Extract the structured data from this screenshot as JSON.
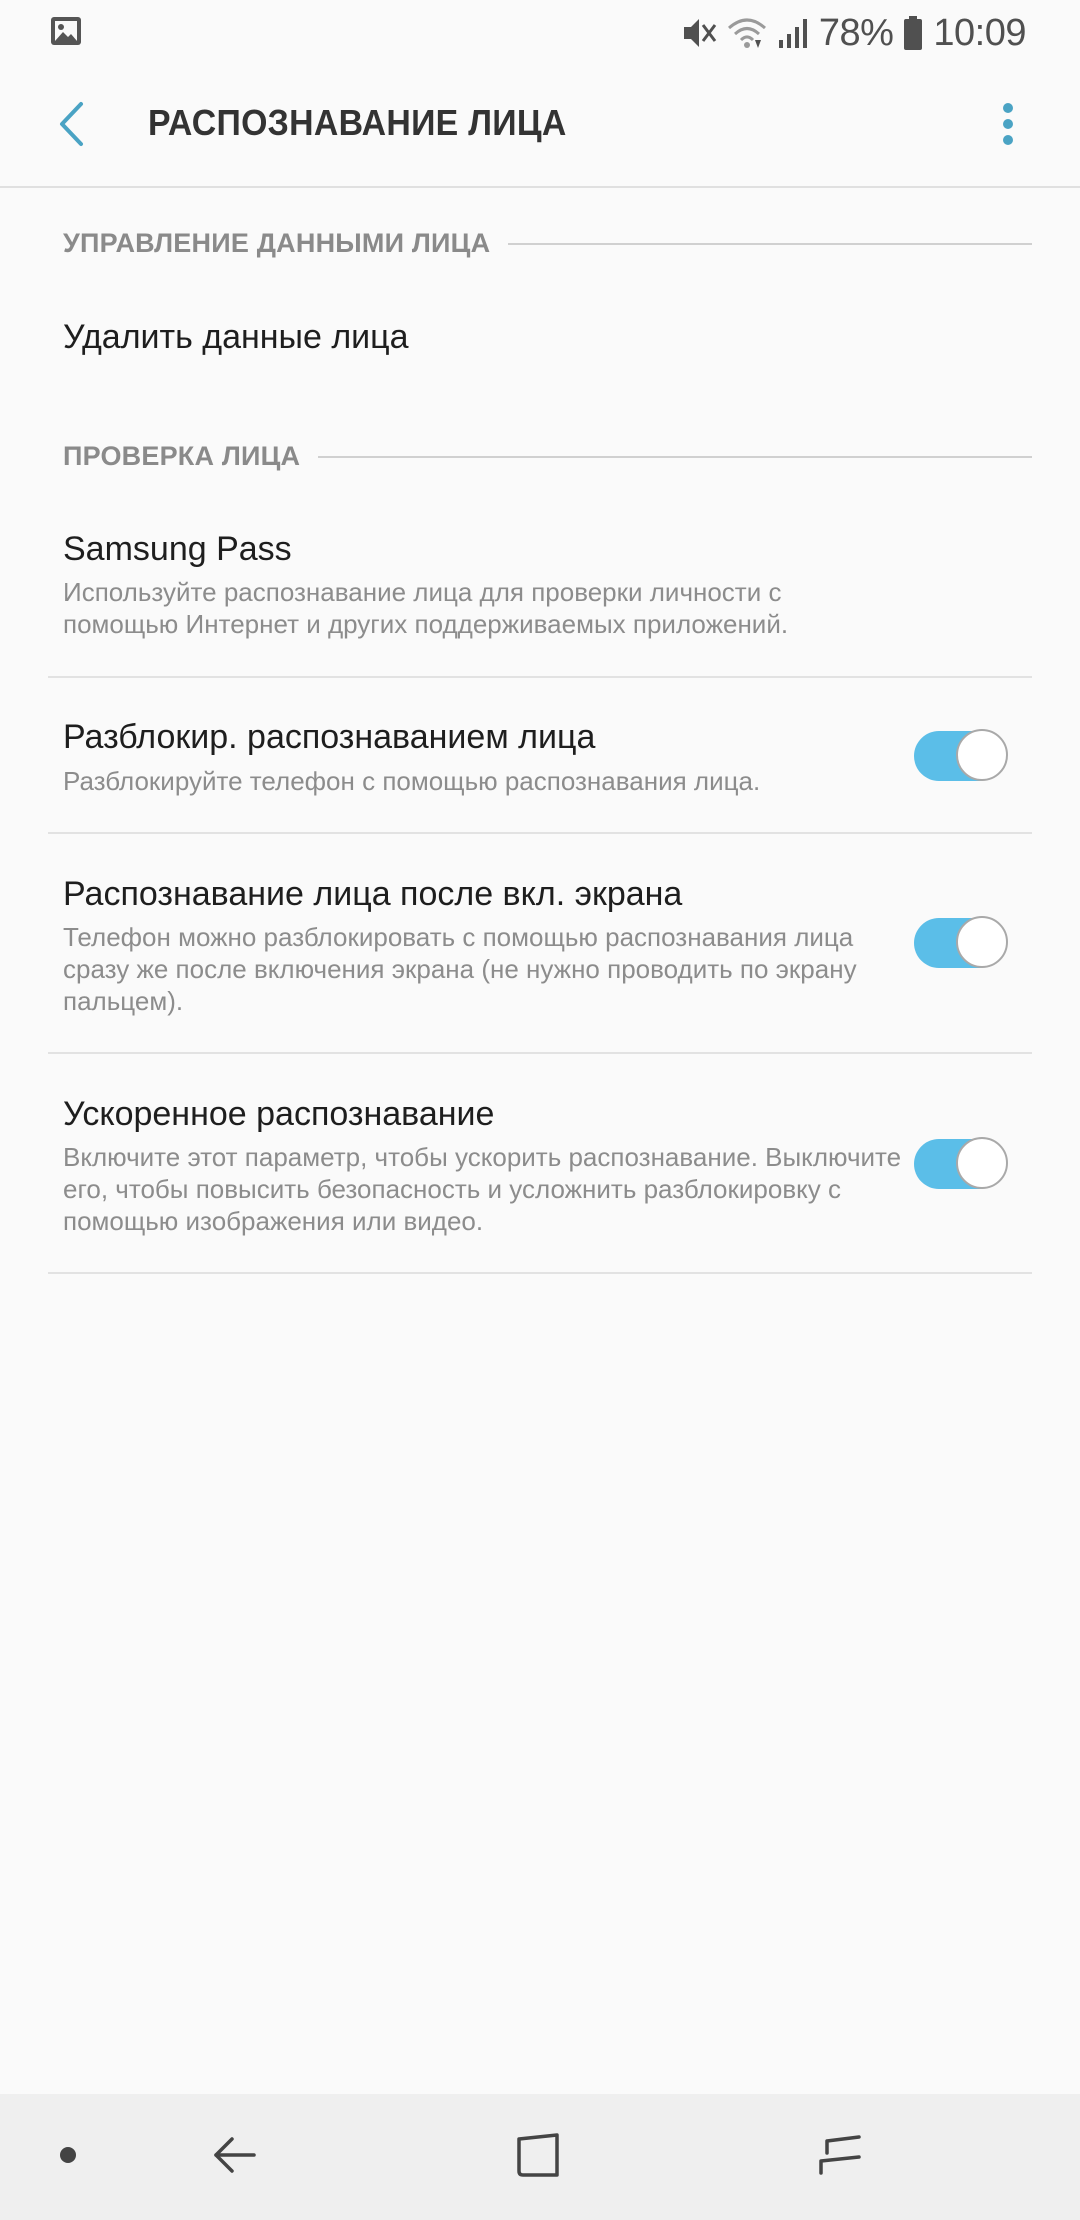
{
  "status_bar": {
    "battery_percent": "78%",
    "time": "10:09",
    "icons": [
      "image-icon",
      "mute-icon",
      "wifi-icon",
      "signal-icon",
      "battery-icon"
    ]
  },
  "header": {
    "title": "РАСПОЗНАВАНИЕ ЛИЦА"
  },
  "sections": [
    {
      "header": "УПРАВЛЕНИЕ ДАННЫМИ ЛИЦА",
      "items": [
        {
          "title": "Удалить данные лица"
        }
      ]
    },
    {
      "header": "ПРОВЕРКА ЛИЦА",
      "items": [
        {
          "title": "Samsung Pass",
          "summary": "Используйте распознавание лица для проверки личности с помощью Интернет и других поддерживаемых приложений."
        },
        {
          "title": "Разблокир. распознаванием лица",
          "summary": "Разблокируйте телефон с помощью распознавания лица.",
          "enabled": true
        },
        {
          "title": "Распознавание лица после вкл. экрана",
          "summary": "Телефон можно разблокировать с помощью распознавания лица сразу же после включения экрана (не нужно проводить по экрану пальцем).",
          "enabled": true
        },
        {
          "title": "Ускоренное распознавание",
          "summary": "Включите этот параметр, чтобы ускорить распознавание. Выключите его, чтобы повысить безопасность и усложнить разблокировку с помощью изображения или видео.",
          "enabled": true
        }
      ]
    }
  ],
  "colors": {
    "accent": "#4aa3c4",
    "toggle_on": "#5bbee8",
    "background": "#fafafa"
  }
}
